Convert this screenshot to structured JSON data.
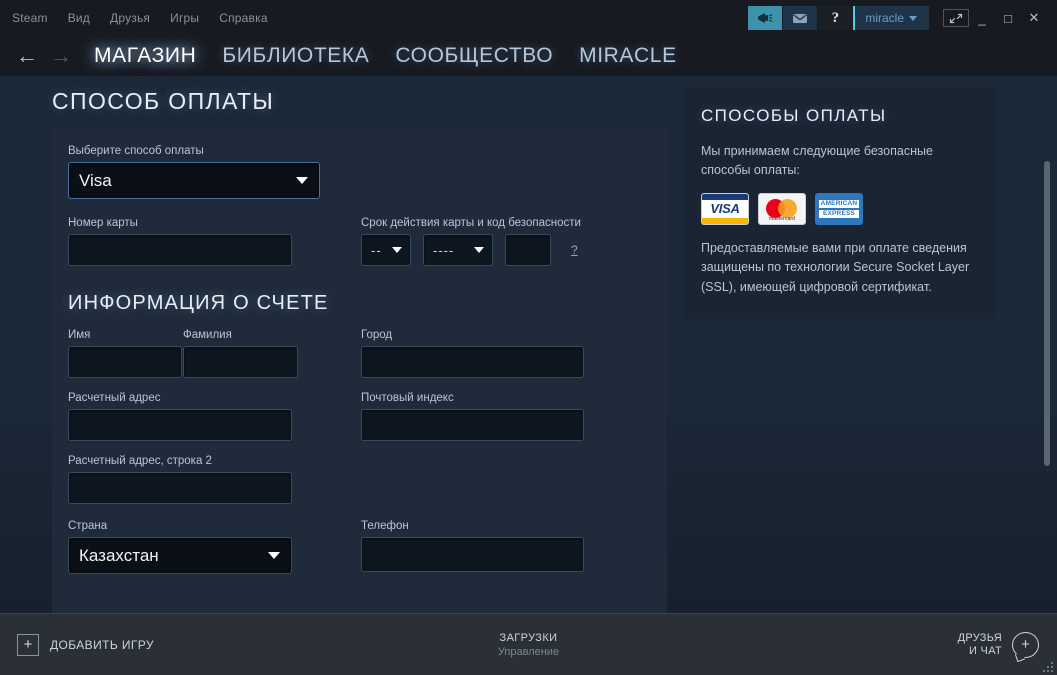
{
  "window": {
    "menu": [
      "Steam",
      "Вид",
      "Друзья",
      "Игры",
      "Справка"
    ],
    "broadcast_icon": "megaphone-icon",
    "mail_icon": "envelope-icon",
    "help_label": "?",
    "username": "miracle",
    "expand_icon": "expand-arrows-icon",
    "minimize_label": "_",
    "maximize_label": "□",
    "close_label": "✕"
  },
  "nav": {
    "back_label": "←",
    "forward_label": "→",
    "tabs": [
      {
        "label": "МАГАЗИН",
        "active": true
      },
      {
        "label": "БИБЛИОТЕКА",
        "active": false
      },
      {
        "label": "СООБЩЕСТВО",
        "active": false
      },
      {
        "label": "MIRACLE",
        "active": false
      }
    ]
  },
  "payment": {
    "heading": "СПОСОБ ОПЛАТЫ",
    "method_label": "Выберите способ оплаты",
    "method_value": "Visa",
    "card_number_label": "Номер карты",
    "card_number_value": "",
    "expiry_label": "Срок действия карты и код безопасности",
    "expiry_month_value": "--",
    "expiry_year_value": "----",
    "cvv_value": "",
    "cvv_help_label": "?"
  },
  "billing": {
    "heading": "ИНФОРМАЦИЯ О СЧЕТЕ",
    "first_name_label": "Имя",
    "first_name_value": "",
    "last_name_label": "Фамилия",
    "last_name_value": "",
    "city_label": "Город",
    "city_value": "",
    "address1_label": "Расчетный адрес",
    "address1_value": "",
    "zip_label": "Почтовый индекс",
    "zip_value": "",
    "address2_label": "Расчетный адрес, строка 2",
    "address2_value": "",
    "country_label": "Страна",
    "country_value": "Казахстан",
    "phone_label": "Телефон",
    "phone_value": ""
  },
  "sidebar": {
    "heading": "СПОСОБЫ ОПЛАТЫ",
    "intro": "Мы принимаем следующие безопасные способы оплаты:",
    "cards": [
      {
        "name": "visa-card-logo",
        "label": "VISA"
      },
      {
        "name": "mastercard-card-logo",
        "label": "mastercard"
      },
      {
        "name": "amex-card-logo",
        "label_line1": "AMERICAN",
        "label_line2": "EXPRESS"
      }
    ],
    "ssl_text": "Предоставляемые вами при оплате сведения защищены по технологии Secure Socket Layer (SSL), имеющей цифровой сертификат."
  },
  "footer": {
    "add_game_label": "ДОБАВИТЬ ИГРУ",
    "add_game_icon": "plus-icon",
    "downloads_title": "ЗАГРУЗКИ",
    "downloads_sub": "Управление",
    "friends_line1": "ДРУЗЬЯ",
    "friends_line2": "И ЧАТ",
    "friends_icon": "chat-plus-icon"
  },
  "colors": {
    "accent_teal": "#3d93ac",
    "focus_blue": "#4a6f9e",
    "panel": "#1f2b3a",
    "page_bg": "#1b2838"
  }
}
